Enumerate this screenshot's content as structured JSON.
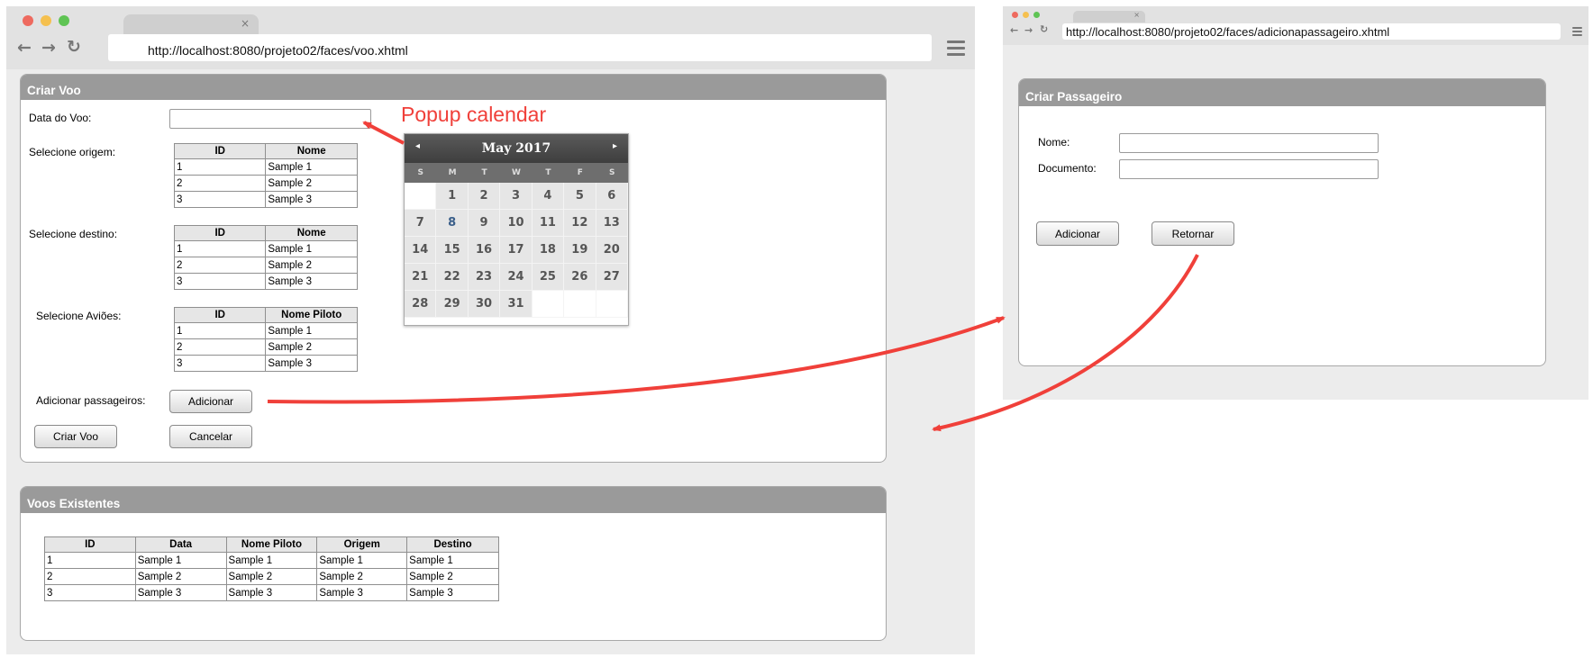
{
  "windows": {
    "main": {
      "url": "http://localhost:8080/projeto02/faces/voo.xhtml",
      "tab_close": "×"
    },
    "secondary": {
      "url": "http://localhost:8080/projeto02/faces/adicionapassageiro.xhtml",
      "tab_close": "×"
    }
  },
  "nav_icons": [
    "back-arrow-icon",
    "forward-arrow-icon",
    "reload-icon",
    "menu-icon"
  ],
  "criar_voo": {
    "title": "Criar Voo",
    "data_label": "Data do Voo:",
    "data_value": "",
    "origem_label": "Selecione origem:",
    "destino_label": "Selecione destino:",
    "avioes_label": "Selecione Aviões:",
    "passageiros_label": "Adicionar passageiros:",
    "adicionar_button": "Adicionar",
    "criar_button": "Criar Voo",
    "cancelar_button": "Cancelar",
    "origem_table": {
      "headers": [
        "ID",
        "Nome"
      ],
      "rows": [
        [
          "1",
          "Sample 1"
        ],
        [
          "2",
          "Sample 2"
        ],
        [
          "3",
          "Sample 3"
        ]
      ]
    },
    "destino_table": {
      "headers": [
        "ID",
        "Nome"
      ],
      "rows": [
        [
          "1",
          "Sample 1"
        ],
        [
          "2",
          "Sample 2"
        ],
        [
          "3",
          "Sample 3"
        ]
      ]
    },
    "avioes_table": {
      "headers": [
        "ID",
        "Nome Piloto"
      ],
      "rows": [
        [
          "1",
          "Sample 1"
        ],
        [
          "2",
          "Sample 2"
        ],
        [
          "3",
          "Sample 3"
        ]
      ]
    }
  },
  "voos_existentes": {
    "title": "Voos Existentes",
    "table": {
      "headers": [
        "ID",
        "Data",
        "Nome Piloto",
        "Origem",
        "Destino"
      ],
      "rows": [
        [
          "1",
          "Sample 1",
          "Sample 1",
          "Sample 1",
          "Sample 1"
        ],
        [
          "2",
          "Sample 2",
          "Sample 2",
          "Sample 2",
          "Sample 2"
        ],
        [
          "3",
          "Sample 3",
          "Sample 3",
          "Sample 3",
          "Sample 3"
        ]
      ]
    }
  },
  "calendar": {
    "month": "May 2017",
    "prev": "◂",
    "next": "▸",
    "weekdays": [
      "S",
      "M",
      "T",
      "W",
      "T",
      "F",
      "S"
    ],
    "leading_blanks": 1,
    "days": 31,
    "highlighted_day": 8
  },
  "annotation": "Popup calendar",
  "criar_passageiro": {
    "title": "Criar Passageiro",
    "nome_label": "Nome:",
    "nome_value": "",
    "documento_label": "Documento:",
    "documento_value": "",
    "adicionar_button": "Adicionar",
    "retornar_button": "Retornar"
  },
  "colors": {
    "panel_header": "#9a9a9a",
    "annotation": "#f0403a",
    "traffic_red": "#ee6a5f",
    "traffic_yellow": "#f5c04f",
    "traffic_green": "#5fc454"
  }
}
